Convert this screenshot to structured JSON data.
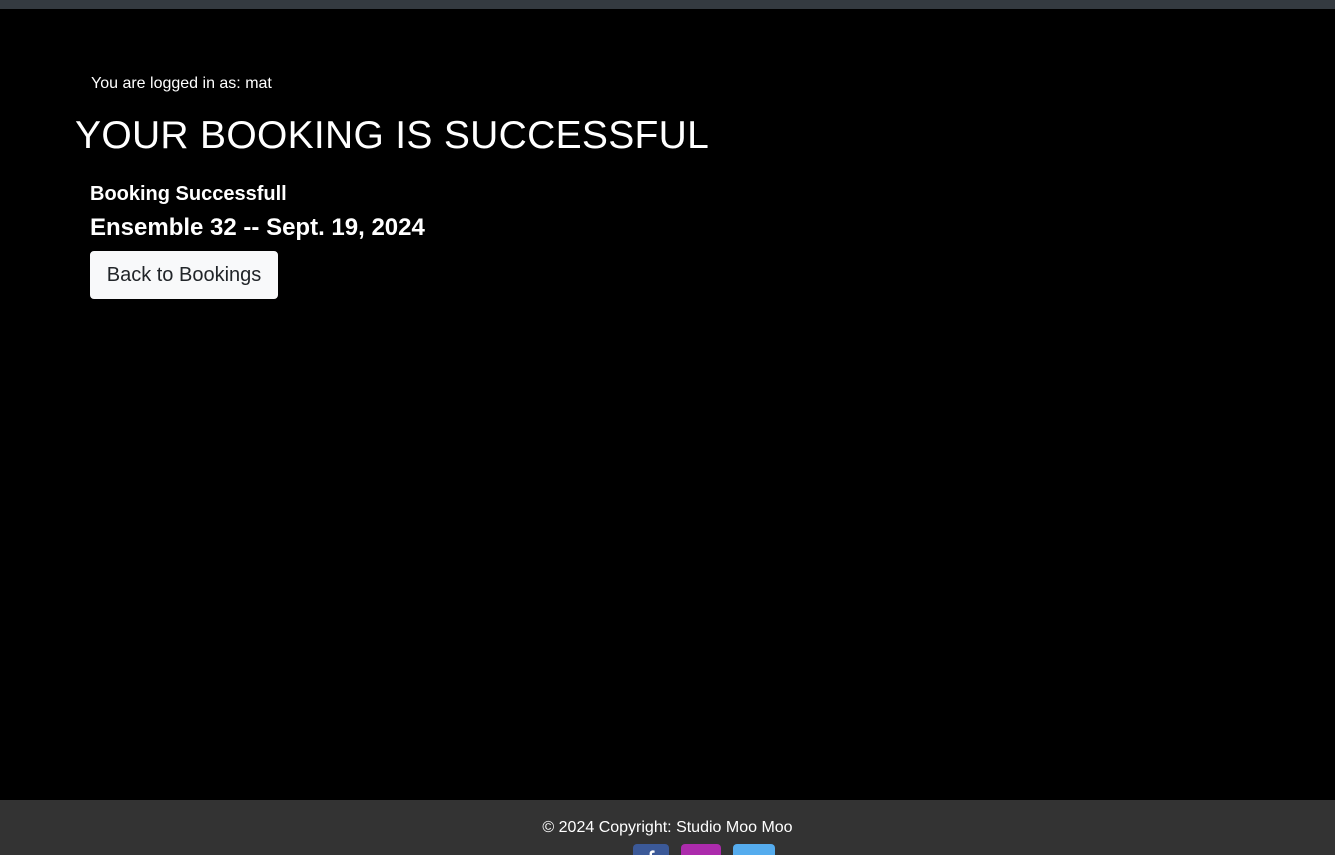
{
  "header": {
    "login_status": "You are logged in as: mat"
  },
  "main": {
    "title": "YOUR BOOKING IS SUCCESSFUL",
    "status": "Booking Successfull",
    "booking": "Ensemble 32 -- Sept. 19, 2024",
    "back_button_label": "Back to Bookings"
  },
  "footer": {
    "copyright": "© 2024 Copyright: Studio Moo Moo",
    "social": [
      {
        "icon": "facebook-icon",
        "color": "#3b5998"
      },
      {
        "icon": "instagram-icon",
        "color": "#ac2bac"
      },
      {
        "icon": "twitter-icon",
        "color": "#55acee"
      }
    ]
  },
  "colors": {
    "page_background": "#000000",
    "topbar": "#343a40",
    "footer_background": "#333333",
    "button_background": "#f8f9fa",
    "button_text": "#212529"
  }
}
